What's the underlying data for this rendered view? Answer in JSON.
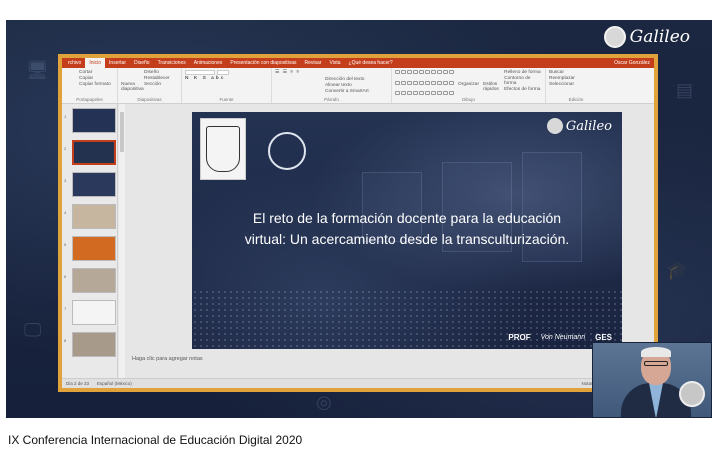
{
  "channel": {
    "logo_text": "Galileo"
  },
  "ppt": {
    "tabs": [
      "rchivo",
      "Inicio",
      "Insertar",
      "Diseño",
      "Transiciones",
      "Animaciones",
      "Presentación con diapositivas",
      "Revisar",
      "Vista",
      "¿Qué desea hacer?"
    ],
    "active_tab": "Inicio",
    "user": "Oscar González",
    "ribbon": {
      "clipboard": {
        "items": [
          "Cortar",
          "Copiar",
          "Copiar formato"
        ],
        "group": "Portapapeles"
      },
      "slides": {
        "new": "Nueva diapositiva",
        "items": [
          "Diseño",
          "Restablecer",
          "Sección"
        ],
        "group": "Diapositivas"
      },
      "font": {
        "group": "Fuente"
      },
      "paragraph": {
        "items": [
          "Dirección del texto",
          "Alinear texto",
          "Convertir a SmartArt"
        ],
        "group": "Párrafo"
      },
      "drawing": {
        "organize": "Organizar",
        "styles": "Estilos rápidos",
        "items": [
          "Relleno de forma",
          "Contorno de forma",
          "Efectos de forma"
        ],
        "group": "Dibujo"
      },
      "editing": {
        "items": [
          "Buscar",
          "Reemplazar",
          "Seleccionar"
        ],
        "group": "Edición"
      }
    },
    "thumbnails": [
      {
        "num": "1",
        "selected": false
      },
      {
        "num": "2",
        "selected": true
      },
      {
        "num": "3",
        "selected": false
      },
      {
        "num": "4",
        "selected": false
      },
      {
        "num": "5",
        "selected": false
      },
      {
        "num": "6",
        "selected": false
      },
      {
        "num": "7",
        "selected": false
      },
      {
        "num": "8",
        "selected": false
      }
    ],
    "slide": {
      "logo_text": "Galileo",
      "title": "El reto de la formación docente para la educación virtual: Un acercamiento desde la transculturización.",
      "sponsors": [
        "PROF",
        "Von Neumann",
        "GES"
      ]
    },
    "notes_placeholder": "Haga clic para agregar notas",
    "status": {
      "slide_count": "Dia   2 de 33",
      "language": "Español (México)",
      "notes": "Notas",
      "comments": "Comentarios"
    }
  },
  "caption": "IX Conferencia Internacional de Educación Digital 2020"
}
